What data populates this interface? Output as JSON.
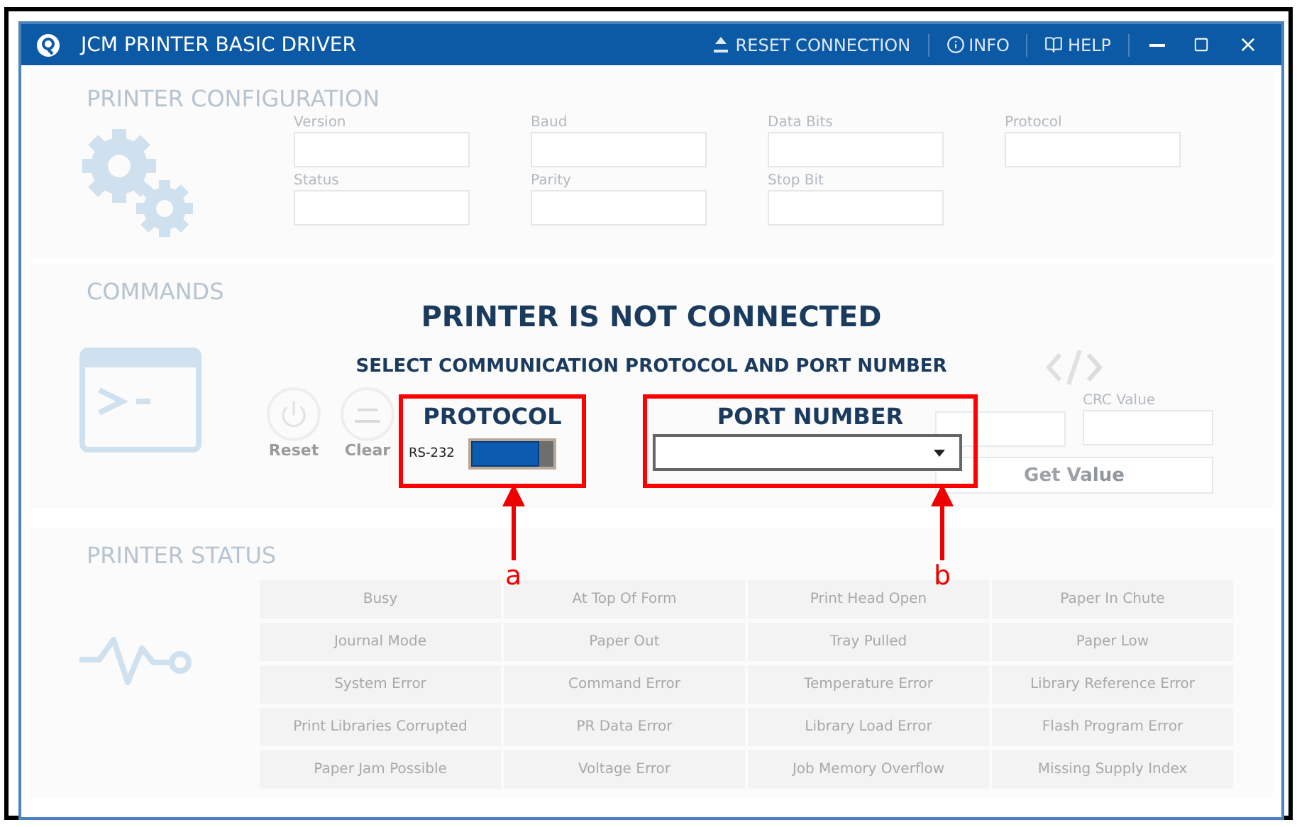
{
  "window": {
    "title": "JCM PRINTER BASIC DRIVER",
    "actions": [
      {
        "label": "RESET CONNECTION",
        "kind": "reset"
      },
      {
        "label": "INFO",
        "kind": "info"
      },
      {
        "label": "HELP",
        "kind": "help"
      }
    ]
  },
  "configuration": {
    "title": "PRINTER CONFIGURATION",
    "fields": [
      {
        "label": "Version"
      },
      {
        "label": "Baud"
      },
      {
        "label": "Data Bits"
      },
      {
        "label": "Protocol"
      },
      {
        "label": "Status"
      },
      {
        "label": "Parity"
      },
      {
        "label": "Stop Bit"
      }
    ]
  },
  "commands": {
    "title": "COMMANDS",
    "buttons": [
      {
        "label": "Reset",
        "kind": "power"
      },
      {
        "label": "Clear",
        "kind": "text"
      }
    ],
    "crc_fields": [
      {
        "kind": "seed"
      },
      {
        "kind": "value",
        "label": "CRC Value"
      }
    ],
    "get_value": "Get Value"
  },
  "status": {
    "title": "PRINTER STATUS",
    "flags": [
      "Busy",
      "At Top Of Form",
      "Print Head Open",
      "Paper In Chute",
      "Journal Mode",
      "Paper Out",
      "Tray Pulled",
      "Paper Low",
      "System Error",
      "Command Error",
      "Temperature Error",
      "Library Reference Error",
      "Print Libraries Corrupted",
      "PR Data Error",
      "Library Load Error",
      "Flash Program Error",
      "Paper Jam Possible",
      "Voltage Error",
      "Job Memory Overflow",
      "Missing Supply Index"
    ]
  },
  "dialog": {
    "title": "PRINTER IS NOT CONNECTED",
    "subtitle": "SELECT COMMUNICATION PROTOCOL AND PORT NUMBER",
    "protocol": {
      "label": "PROTOCOL",
      "value": "RS-232",
      "on": true
    },
    "port": {
      "label": "PORT NUMBER"
    }
  },
  "callouts": [
    "a",
    "b"
  ]
}
